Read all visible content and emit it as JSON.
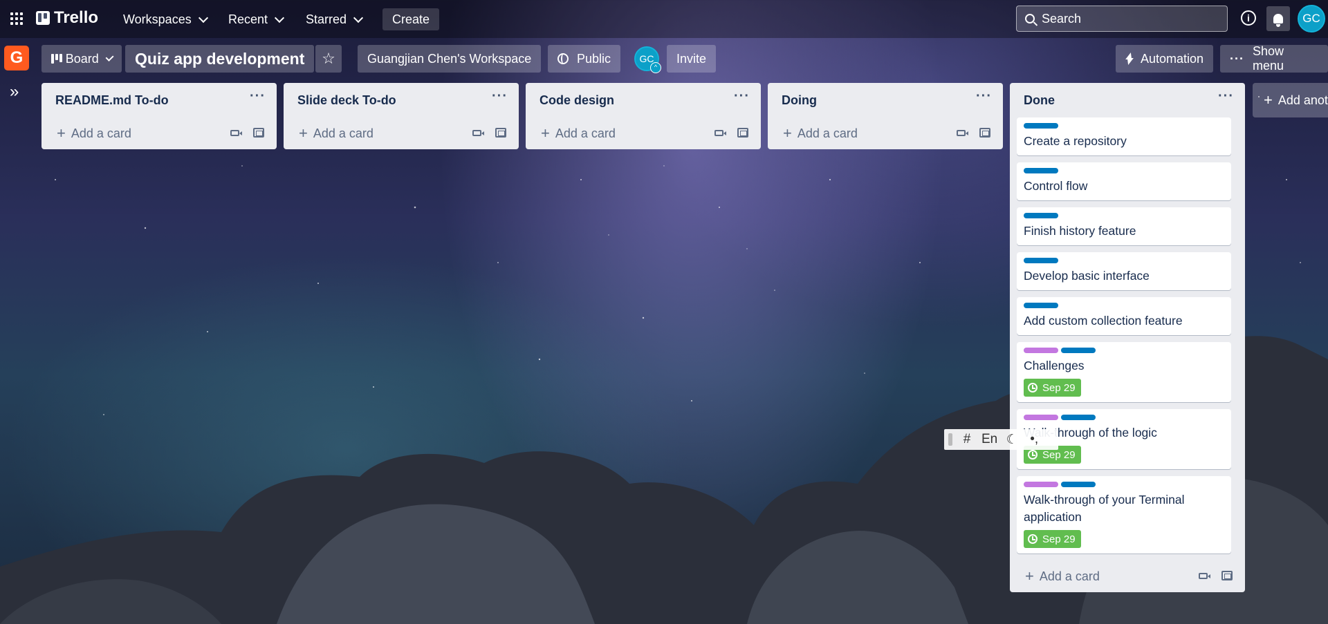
{
  "topnav": {
    "brand": "Trello",
    "workspaces": "Workspaces",
    "recent": "Recent",
    "starred": "Starred",
    "create": "Create",
    "search_placeholder": "Search",
    "avatar": "GC"
  },
  "board_header": {
    "workspace_initial": "G",
    "view": "Board",
    "title": "Quiz app development",
    "workspace": "Guangjian Chen's Workspace",
    "visibility": "Public",
    "member_initials": "GC",
    "invite": "Invite",
    "automation": "Automation",
    "show_menu": "Show menu"
  },
  "add_card_label": "Add a card",
  "add_list_label": "Add another list",
  "lists": [
    {
      "title": "README.md To-do"
    },
    {
      "title": "Slide deck To-do"
    },
    {
      "title": "Code design"
    },
    {
      "title": "Doing"
    },
    {
      "title": "Done"
    }
  ],
  "done_cards": [
    {
      "title": "Create a repository"
    },
    {
      "title": "Control flow"
    },
    {
      "title": "Finish history feature"
    },
    {
      "title": "Develop basic interface"
    },
    {
      "title": "Add custom collection feature"
    },
    {
      "title": "Challenges",
      "due": "Sep 29"
    },
    {
      "title": "Walk-through of the logic",
      "due": "Sep 29"
    },
    {
      "title": "Walk-through of your Terminal application",
      "due": "Sep 29"
    }
  ],
  "label_colors": {
    "blue": "#0079bf",
    "purple": "#c377e0"
  },
  "ime": {
    "hash": "#",
    "lang": "En",
    "moon": "☾",
    "punct": "•,"
  }
}
